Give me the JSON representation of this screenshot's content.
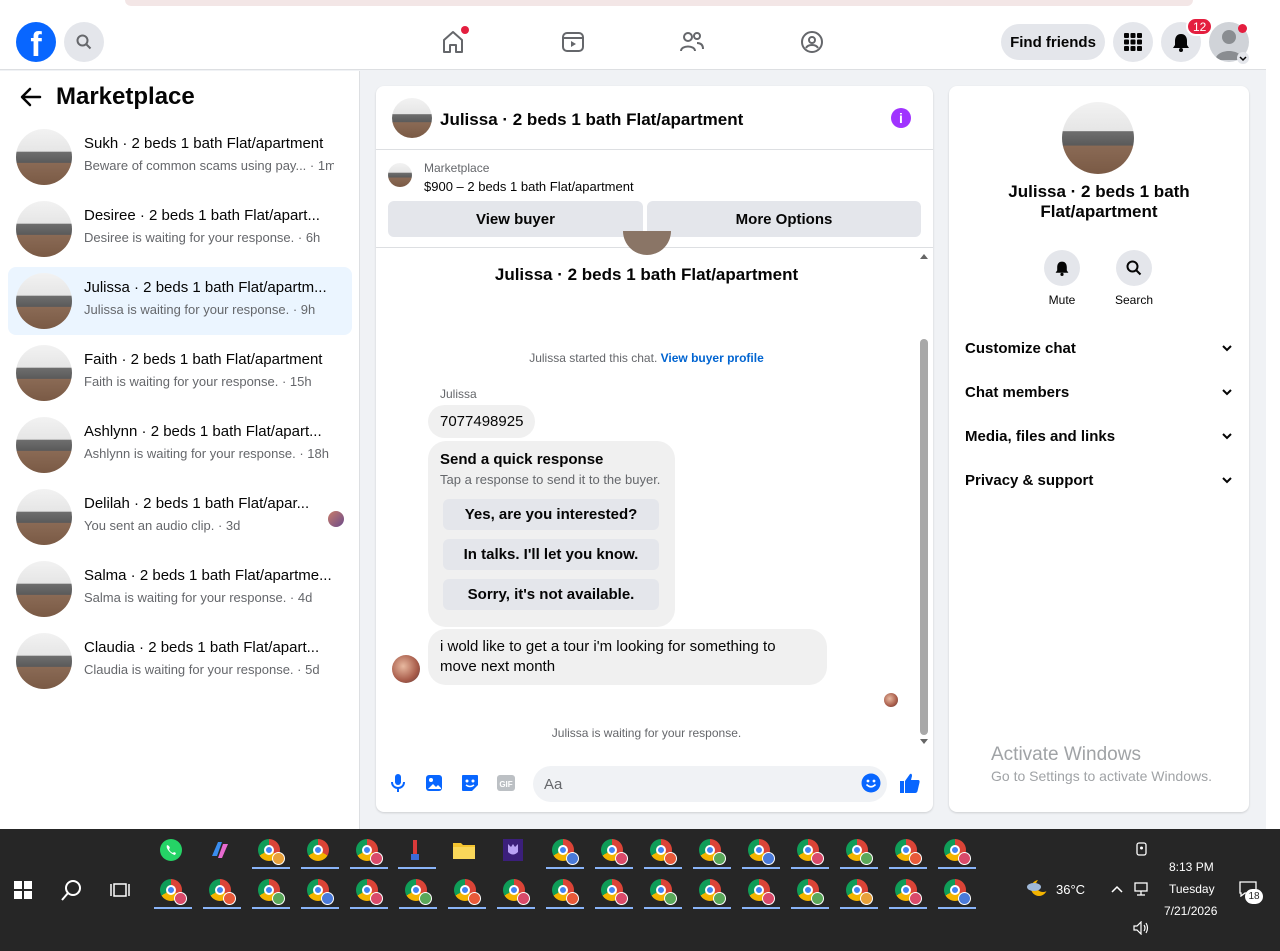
{
  "nav": {
    "logo": "f",
    "find_friends": "Find friends",
    "notif_count": "12"
  },
  "sidebar": {
    "title": "Marketplace",
    "conversations": [
      {
        "title": "Sukh · 2 beds 1 bath Flat/apartment",
        "subtitle": "Beware of common scams using pay... · 1m"
      },
      {
        "title": "Desiree · 2 beds 1 bath Flat/apart...",
        "subtitle": "Desiree is waiting for your response. · 6h"
      },
      {
        "title": "Julissa · 2 beds 1 bath Flat/apartm...",
        "subtitle": "Julissa is waiting for your response. · 9h"
      },
      {
        "title": "Faith · 2 beds 1 bath Flat/apartment",
        "subtitle": "Faith is waiting for your response. · 15h"
      },
      {
        "title": "Ashlynn · 2 beds 1 bath Flat/apart...",
        "subtitle": "Ashlynn is waiting for your response. · 18h"
      },
      {
        "title": "Delilah · 2 beds 1 bath Flat/apar...",
        "subtitle": "You sent an audio clip. · 3d"
      },
      {
        "title": "Salma · 2 beds 1 bath Flat/apartme...",
        "subtitle": "Salma is waiting for your response. · 4d"
      },
      {
        "title": "Claudia · 2 beds 1 bath Flat/apart...",
        "subtitle": "Claudia is waiting for your response. · 5d"
      }
    ]
  },
  "chat": {
    "title": "Julissa · 2 beds 1 bath Flat/apartment",
    "marketplace_label": "Marketplace",
    "listing": "$900 – 2 beds 1 bath Flat/apartment",
    "view_buyer": "View buyer",
    "more_options": "More Options",
    "body_title": "Julissa · 2 beds 1 bath Flat/apartment",
    "started_text": "Julissa started this chat.",
    "view_buyer_profile": "View buyer profile",
    "sender": "Julissa",
    "phone_message": "7077498925",
    "quick_title": "Send a quick response",
    "quick_sub": "Tap a response to send it to the buyer.",
    "quick_replies": [
      "Yes, are you interested?",
      "In talks. I'll let you know.",
      "Sorry, it's not available."
    ],
    "message": "i wold like to get a tour i'm looking for something to move next month",
    "waiting": "Julissa is waiting for your response.",
    "input_placeholder": "Aa"
  },
  "details": {
    "name": "Julissa · 2 beds 1 bath Flat/apartment",
    "mute": "Mute",
    "search": "Search",
    "sections": [
      "Customize chat",
      "Chat members",
      "Media, files and links",
      "Privacy & support"
    ]
  },
  "watermark": {
    "line1": "Activate Windows",
    "line2": "Go to Settings to activate Windows."
  },
  "taskbar": {
    "weather": "36°C",
    "time": "8:13 PM",
    "day": "Tuesday",
    "date": "7/21/2026",
    "notif": "18"
  },
  "colors": {
    "brand": "#0866ff",
    "accent_purple": "#a033ff",
    "notification_red": "#e41e3f",
    "active_row": "#ebf5ff"
  }
}
